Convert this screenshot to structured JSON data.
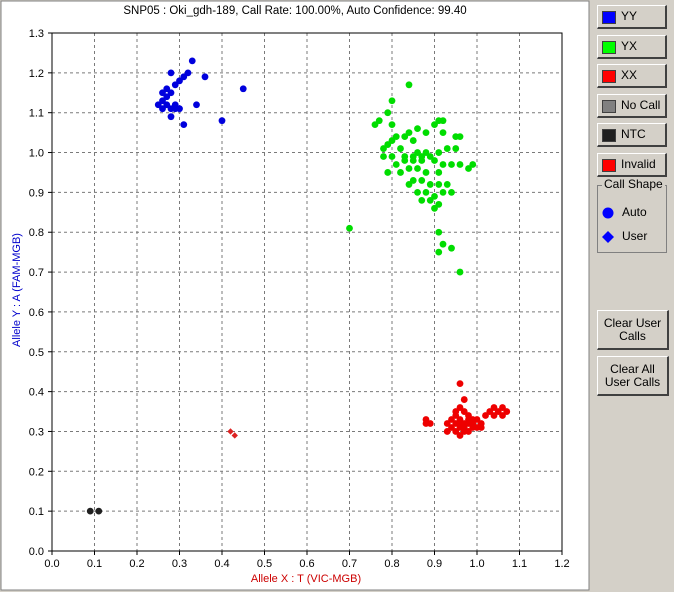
{
  "chart_data": {
    "type": "scatter",
    "title": "SNP05 : Oki_gdh-189, Call Rate: 100.00%, Auto Confidence: 99.40",
    "xlabel": "Allele X : T (VIC-MGB)",
    "ylabel": "Allele Y : A (FAM-MGB)",
    "xlim": [
      0,
      1.2
    ],
    "ylim": [
      0,
      1.3
    ],
    "xticks": [
      "0.0",
      "0.1",
      "0.2",
      "0.3",
      "0.4",
      "0.5",
      "0.6",
      "0.7",
      "0.8",
      "0.9",
      "1.0",
      "1.1",
      "1.2"
    ],
    "yticks": [
      "0.0",
      "0.1",
      "0.2",
      "0.3",
      "0.4",
      "0.5",
      "0.6",
      "0.7",
      "0.8",
      "0.9",
      "1.0",
      "1.1",
      "1.2",
      "1.3"
    ],
    "grid": true,
    "series": [
      {
        "name": "YY",
        "color": "#0000dd",
        "marker": "circle",
        "points": [
          [
            0.33,
            1.23
          ],
          [
            0.28,
            1.2
          ],
          [
            0.32,
            1.2
          ],
          [
            0.3,
            1.18
          ],
          [
            0.31,
            1.19
          ],
          [
            0.36,
            1.19
          ],
          [
            0.29,
            1.17
          ],
          [
            0.27,
            1.16
          ],
          [
            0.26,
            1.15
          ],
          [
            0.28,
            1.15
          ],
          [
            0.27,
            1.14
          ],
          [
            0.26,
            1.13
          ],
          [
            0.27,
            1.12
          ],
          [
            0.25,
            1.12
          ],
          [
            0.26,
            1.11
          ],
          [
            0.28,
            1.11
          ],
          [
            0.29,
            1.11
          ],
          [
            0.34,
            1.12
          ],
          [
            0.28,
            1.09
          ],
          [
            0.31,
            1.07
          ],
          [
            0.4,
            1.08
          ],
          [
            0.45,
            1.16
          ],
          [
            0.29,
            1.12
          ],
          [
            0.3,
            1.11
          ]
        ]
      },
      {
        "name": "YX",
        "color": "#00dd00",
        "marker": "circle",
        "points": [
          [
            0.84,
            1.17
          ],
          [
            0.8,
            1.13
          ],
          [
            0.79,
            1.1
          ],
          [
            0.77,
            1.08
          ],
          [
            0.76,
            1.07
          ],
          [
            0.8,
            1.07
          ],
          [
            0.86,
            1.06
          ],
          [
            0.84,
            1.05
          ],
          [
            0.83,
            1.04
          ],
          [
            0.85,
            1.03
          ],
          [
            0.88,
            1.05
          ],
          [
            0.9,
            1.07
          ],
          [
            0.91,
            1.08
          ],
          [
            0.92,
            1.08
          ],
          [
            0.92,
            1.05
          ],
          [
            0.95,
            1.04
          ],
          [
            0.96,
            1.04
          ],
          [
            0.81,
            1.04
          ],
          [
            0.8,
            1.03
          ],
          [
            0.79,
            1.02
          ],
          [
            0.78,
            1.01
          ],
          [
            0.82,
            1.01
          ],
          [
            0.86,
            1.0
          ],
          [
            0.88,
            1.0
          ],
          [
            0.89,
            0.99
          ],
          [
            0.91,
            1.0
          ],
          [
            0.93,
            1.01
          ],
          [
            0.95,
            1.01
          ],
          [
            0.78,
            0.99
          ],
          [
            0.8,
            0.99
          ],
          [
            0.83,
            0.99
          ],
          [
            0.85,
            0.98
          ],
          [
            0.87,
            0.98
          ],
          [
            0.9,
            0.98
          ],
          [
            0.92,
            0.97
          ],
          [
            0.94,
            0.97
          ],
          [
            0.96,
            0.97
          ],
          [
            0.99,
            0.97
          ],
          [
            0.98,
            0.96
          ],
          [
            0.81,
            0.97
          ],
          [
            0.84,
            0.96
          ],
          [
            0.86,
            0.96
          ],
          [
            0.88,
            0.95
          ],
          [
            0.91,
            0.95
          ],
          [
            0.79,
            0.95
          ],
          [
            0.82,
            0.95
          ],
          [
            0.85,
            0.93
          ],
          [
            0.87,
            0.93
          ],
          [
            0.89,
            0.92
          ],
          [
            0.91,
            0.92
          ],
          [
            0.93,
            0.92
          ],
          [
            0.84,
            0.92
          ],
          [
            0.86,
            0.9
          ],
          [
            0.88,
            0.9
          ],
          [
            0.9,
            0.89
          ],
          [
            0.92,
            0.9
          ],
          [
            0.94,
            0.9
          ],
          [
            0.89,
            0.88
          ],
          [
            0.91,
            0.87
          ],
          [
            0.87,
            0.88
          ],
          [
            0.9,
            0.86
          ],
          [
            0.91,
            0.8
          ],
          [
            0.92,
            0.77
          ],
          [
            0.91,
            0.75
          ],
          [
            0.94,
            0.76
          ],
          [
            0.96,
            0.7
          ],
          [
            0.7,
            0.81
          ],
          [
            0.83,
            0.98
          ],
          [
            0.85,
            0.99
          ],
          [
            0.87,
            0.99
          ]
        ]
      },
      {
        "name": "XX",
        "color": "#ee0000",
        "marker": "circle",
        "points": [
          [
            0.96,
            0.42
          ],
          [
            0.97,
            0.38
          ],
          [
            0.96,
            0.36
          ],
          [
            0.95,
            0.35
          ],
          [
            0.97,
            0.35
          ],
          [
            0.98,
            0.34
          ],
          [
            0.95,
            0.34
          ],
          [
            0.94,
            0.33
          ],
          [
            0.96,
            0.33
          ],
          [
            0.98,
            0.33
          ],
          [
            0.99,
            0.33
          ],
          [
            1.0,
            0.33
          ],
          [
            0.93,
            0.32
          ],
          [
            0.95,
            0.32
          ],
          [
            0.96,
            0.32
          ],
          [
            0.97,
            0.32
          ],
          [
            0.98,
            0.32
          ],
          [
            0.99,
            0.32
          ],
          [
            0.94,
            0.31
          ],
          [
            0.96,
            0.31
          ],
          [
            0.97,
            0.31
          ],
          [
            0.99,
            0.31
          ],
          [
            1.01,
            0.32
          ],
          [
            0.95,
            0.3
          ],
          [
            0.97,
            0.3
          ],
          [
            0.98,
            0.3
          ],
          [
            0.96,
            0.29
          ],
          [
            0.88,
            0.33
          ],
          [
            0.89,
            0.32
          ],
          [
            0.88,
            0.32
          ],
          [
            1.02,
            0.34
          ],
          [
            1.03,
            0.35
          ],
          [
            1.04,
            0.36
          ],
          [
            1.05,
            0.35
          ],
          [
            1.06,
            0.36
          ],
          [
            1.07,
            0.35
          ],
          [
            1.06,
            0.34
          ],
          [
            1.04,
            0.34
          ],
          [
            0.93,
            0.3
          ],
          [
            1.0,
            0.31
          ],
          [
            1.01,
            0.31
          ]
        ]
      },
      {
        "name": "Invalid",
        "color": "#dd2222",
        "marker": "diamond",
        "points": [
          [
            0.42,
            0.3
          ],
          [
            0.43,
            0.29
          ]
        ]
      },
      {
        "name": "NTC",
        "color": "#202020",
        "marker": "circle",
        "points": [
          [
            0.09,
            0.1
          ],
          [
            0.11,
            0.1
          ]
        ]
      }
    ]
  },
  "legend_buttons": [
    {
      "label": "YY",
      "color": "#0000ff"
    },
    {
      "label": "YX",
      "color": "#00ff00"
    },
    {
      "label": "XX",
      "color": "#ff0000"
    },
    {
      "label": "No Call",
      "color": "#808080"
    },
    {
      "label": "NTC",
      "color": "#202020"
    },
    {
      "label": "Invalid",
      "color": "#ff0000"
    }
  ],
  "call_shape": {
    "title": "Call Shape",
    "auto_label": "Auto",
    "user_label": "User",
    "icon_color": "#0000ff"
  },
  "actions": {
    "clear_user_calls_line1": "Clear User",
    "clear_user_calls_line2": "Calls",
    "clear_all_line1": "Clear All",
    "clear_all_line2": "User Calls"
  }
}
